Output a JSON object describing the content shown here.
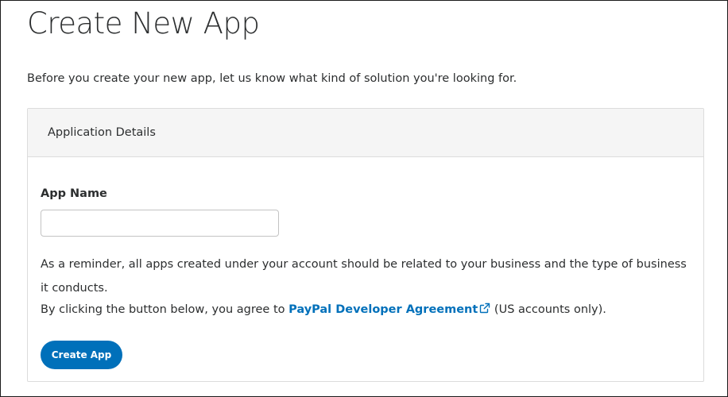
{
  "page": {
    "title": "Create New App",
    "intro": "Before you create your new app, let us know what kind of solution you're looking for."
  },
  "card": {
    "header_title": "Application Details",
    "app_name_label": "App Name",
    "app_name_value": "",
    "app_name_placeholder": "",
    "reminder_text": "As a reminder, all apps created under your account should be related to your business and the type of business it conducts.",
    "agreement_prefix": "By clicking the button below, you agree to ",
    "agreement_link": "PayPal Developer Agreement",
    "agreement_suffix": " (US accounts only).",
    "create_button_label": "Create App"
  },
  "colors": {
    "accent": "#0070ba",
    "header_bg": "#f5f5f5",
    "text": "#2c2e2f"
  },
  "icons": {
    "agreement_link_icon": "external-link-icon"
  }
}
